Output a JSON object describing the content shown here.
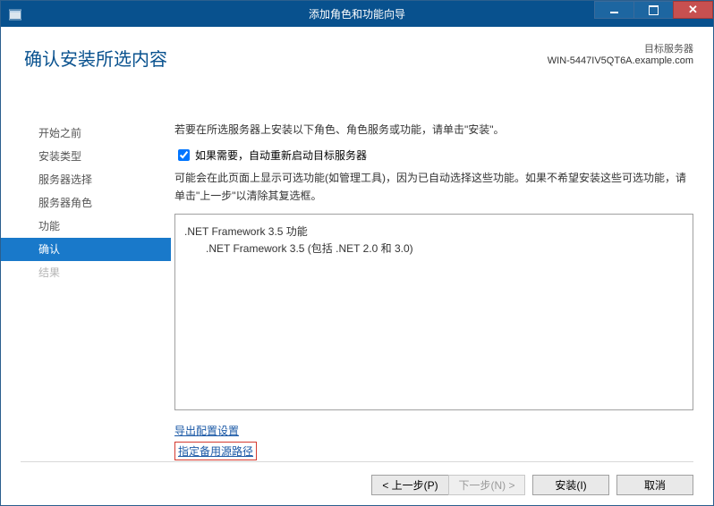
{
  "window": {
    "title": "添加角色和功能向导"
  },
  "header": {
    "page_title": "确认安装所选内容",
    "target_label": "目标服务器",
    "target_server": "WIN-5447IV5QT6A.example.com"
  },
  "sidebar": {
    "items": [
      {
        "label": "开始之前",
        "state": "normal"
      },
      {
        "label": "安装类型",
        "state": "normal"
      },
      {
        "label": "服务器选择",
        "state": "normal"
      },
      {
        "label": "服务器角色",
        "state": "normal"
      },
      {
        "label": "功能",
        "state": "normal"
      },
      {
        "label": "确认",
        "state": "active"
      },
      {
        "label": "结果",
        "state": "disabled"
      }
    ]
  },
  "main": {
    "instruction": "若要在所选服务器上安装以下角色、角色服务或功能，请单击\"安装\"。",
    "checkbox_label": "如果需要，自动重新启动目标服务器",
    "checkbox_checked": true,
    "note": "可能会在此页面上显示可选功能(如管理工具)，因为已自动选择这些功能。如果不希望安装这些可选功能，请单击\"上一步\"以清除其复选框。",
    "features": [
      {
        "level": 0,
        "text": ".NET Framework 3.5 功能"
      },
      {
        "level": 1,
        "text": ".NET Framework 3.5 (包括 .NET 2.0 和 3.0)"
      }
    ],
    "link_export": "导出配置设置",
    "link_alt_source": "指定备用源路径"
  },
  "footer": {
    "prev": "< 上一步(P)",
    "next": "下一步(N) >",
    "install": "安装(I)",
    "cancel": "取消"
  }
}
